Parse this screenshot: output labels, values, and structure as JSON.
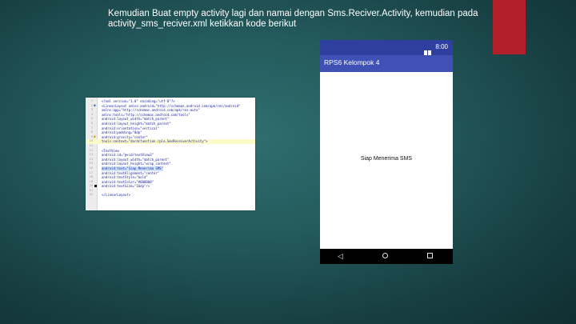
{
  "slide": {
    "text": "Kemudian Buat empty activity lagi dan namai dengan Sms.Reciver.Activity, kemudian pada activity_sms_reciver.xml ketikkan kode berikut",
    "accent_color": "#b3202a"
  },
  "code_editor": {
    "lines": [
      {
        "n": "1",
        "text": "<?xml version=\"1.0\" encoding=\"utf-8\"?>"
      },
      {
        "n": "2",
        "text": "<LinearLayout xmlns:android=\"http://schemas.android.com/apk/res/android\""
      },
      {
        "n": "3",
        "text": "    xmlns:app=\"http://schemas.android.com/apk/res-auto\""
      },
      {
        "n": "4",
        "text": "    xmlns:tools=\"http://schemas.android.com/tools\""
      },
      {
        "n": "5",
        "text": "    android:layout_width=\"match_parent\""
      },
      {
        "n": "6",
        "text": "    android:layout_height=\"match_parent\""
      },
      {
        "n": "7",
        "text": "    android:orientation=\"vertical\""
      },
      {
        "n": "8",
        "text": "    android:padding=\"8dp\""
      },
      {
        "n": "9",
        "text": "    android:gravity=\"center\""
      },
      {
        "n": "10",
        "text": "    tools:context=\"dardcfunction.rplo.SmsReceiverActivity\">"
      },
      {
        "n": "11",
        "text": ""
      },
      {
        "n": "12",
        "text": "    <TextView"
      },
      {
        "n": "13",
        "text": "        android:id=\"@+id/textView3\""
      },
      {
        "n": "14",
        "text": "        android:layout_width=\"match_parent\""
      },
      {
        "n": "15",
        "text": "        android:layout_height=\"wrap_content\""
      },
      {
        "n": "16",
        "text": "        android:text=\"Siap Menerima SMS\""
      },
      {
        "n": "17",
        "text": "        android:textAlignment=\"center\""
      },
      {
        "n": "18",
        "text": "        android:textStyle=\"bold\""
      },
      {
        "n": "19",
        "text": "        android:textColor=\"#000000\""
      },
      {
        "n": "20",
        "text": "        android:textSize=\"16dp\"/>"
      },
      {
        "n": "21",
        "text": ""
      },
      {
        "n": "22",
        "text": "</LinearLayout>"
      }
    ]
  },
  "phone": {
    "status_time": "8:00",
    "app_title": "RPS6 Kelompok 4",
    "content_text": "Siap Menerima SMS",
    "nav": {
      "back": "◁"
    },
    "colors": {
      "appbar": "#3f51b5",
      "statusbar": "#2f3fa0",
      "navbar": "#000000"
    }
  }
}
